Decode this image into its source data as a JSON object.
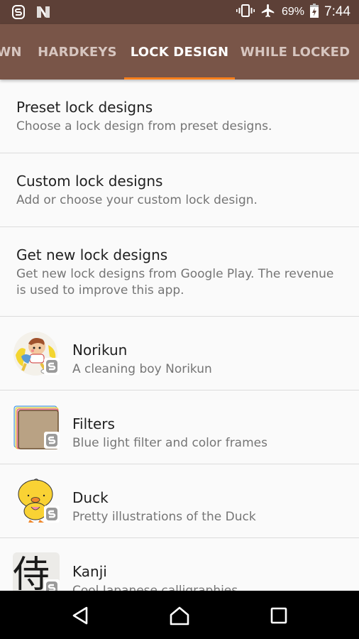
{
  "status_bar": {
    "left_icons": [
      "app-s-icon",
      "n-notification-icon"
    ],
    "right_icons": [
      "vibrate-icon",
      "airplane-mode-icon",
      "battery-charging-icon"
    ],
    "battery": "69%",
    "time": "7:44"
  },
  "tabs": [
    {
      "label": "WN",
      "active": false
    },
    {
      "label": "HARDKEYS",
      "active": false
    },
    {
      "label": "LOCK DESIGN",
      "active": true
    },
    {
      "label": "WHILE LOCKED",
      "active": false
    }
  ],
  "colors": {
    "status_bar": "#5d4037",
    "tab_bar": "#795548",
    "tab_indicator": "#ff7f1a",
    "background": "#fafafa"
  },
  "settings": [
    {
      "title": "Preset lock designs",
      "subtitle": "Choose a lock design from preset designs."
    },
    {
      "title": "Custom lock designs",
      "subtitle": "Add or choose your custom lock design."
    },
    {
      "title": "Get new lock designs",
      "subtitle": "Get new lock designs from Google Play. The revenue is used to improve this app."
    }
  ],
  "designs": [
    {
      "title": "Norikun",
      "subtitle": "A cleaning boy Norikun",
      "icon": "norikun-thumbnail"
    },
    {
      "title": "Filters",
      "subtitle": "Blue light filter and color frames",
      "icon": "filters-thumbnail"
    },
    {
      "title": "Duck",
      "subtitle": "Pretty illustrations of the Duck",
      "icon": "duck-thumbnail"
    },
    {
      "title": "Kanji",
      "subtitle": "Cool Japanese calligraphies",
      "icon": "kanji-thumbnail"
    }
  ],
  "kanji_glyph": "侍",
  "nav_bar": {
    "buttons": [
      "back",
      "home",
      "recents"
    ]
  }
}
